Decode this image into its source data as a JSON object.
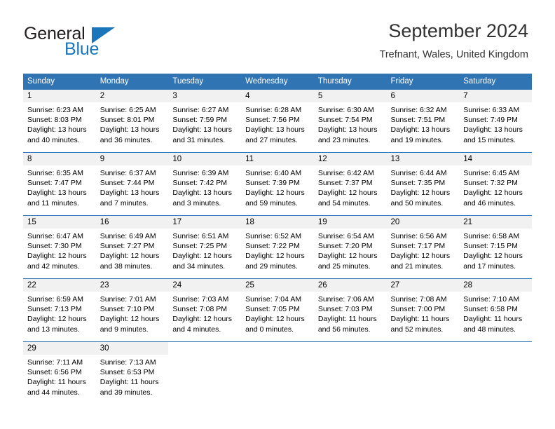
{
  "logo": {
    "word1": "General",
    "word2": "Blue",
    "triangle_color": "#1b75bb"
  },
  "header": {
    "title": "September 2024",
    "subtitle": "Trefnant, Wales, United Kingdom"
  },
  "theme": {
    "header_blue": "#3174b4",
    "daynum_band": "#f1f1f1",
    "text": "#000000"
  },
  "weekday_headers": [
    "Sunday",
    "Monday",
    "Tuesday",
    "Wednesday",
    "Thursday",
    "Friday",
    "Saturday"
  ],
  "weeks": [
    [
      {
        "day": "1",
        "sunrise": "Sunrise: 6:23 AM",
        "sunset": "Sunset: 8:03 PM",
        "daylight1": "Daylight: 13 hours",
        "daylight2": "and 40 minutes."
      },
      {
        "day": "2",
        "sunrise": "Sunrise: 6:25 AM",
        "sunset": "Sunset: 8:01 PM",
        "daylight1": "Daylight: 13 hours",
        "daylight2": "and 36 minutes."
      },
      {
        "day": "3",
        "sunrise": "Sunrise: 6:27 AM",
        "sunset": "Sunset: 7:59 PM",
        "daylight1": "Daylight: 13 hours",
        "daylight2": "and 31 minutes."
      },
      {
        "day": "4",
        "sunrise": "Sunrise: 6:28 AM",
        "sunset": "Sunset: 7:56 PM",
        "daylight1": "Daylight: 13 hours",
        "daylight2": "and 27 minutes."
      },
      {
        "day": "5",
        "sunrise": "Sunrise: 6:30 AM",
        "sunset": "Sunset: 7:54 PM",
        "daylight1": "Daylight: 13 hours",
        "daylight2": "and 23 minutes."
      },
      {
        "day": "6",
        "sunrise": "Sunrise: 6:32 AM",
        "sunset": "Sunset: 7:51 PM",
        "daylight1": "Daylight: 13 hours",
        "daylight2": "and 19 minutes."
      },
      {
        "day": "7",
        "sunrise": "Sunrise: 6:33 AM",
        "sunset": "Sunset: 7:49 PM",
        "daylight1": "Daylight: 13 hours",
        "daylight2": "and 15 minutes."
      }
    ],
    [
      {
        "day": "8",
        "sunrise": "Sunrise: 6:35 AM",
        "sunset": "Sunset: 7:47 PM",
        "daylight1": "Daylight: 13 hours",
        "daylight2": "and 11 minutes."
      },
      {
        "day": "9",
        "sunrise": "Sunrise: 6:37 AM",
        "sunset": "Sunset: 7:44 PM",
        "daylight1": "Daylight: 13 hours",
        "daylight2": "and 7 minutes."
      },
      {
        "day": "10",
        "sunrise": "Sunrise: 6:39 AM",
        "sunset": "Sunset: 7:42 PM",
        "daylight1": "Daylight: 13 hours",
        "daylight2": "and 3 minutes."
      },
      {
        "day": "11",
        "sunrise": "Sunrise: 6:40 AM",
        "sunset": "Sunset: 7:39 PM",
        "daylight1": "Daylight: 12 hours",
        "daylight2": "and 59 minutes."
      },
      {
        "day": "12",
        "sunrise": "Sunrise: 6:42 AM",
        "sunset": "Sunset: 7:37 PM",
        "daylight1": "Daylight: 12 hours",
        "daylight2": "and 54 minutes."
      },
      {
        "day": "13",
        "sunrise": "Sunrise: 6:44 AM",
        "sunset": "Sunset: 7:35 PM",
        "daylight1": "Daylight: 12 hours",
        "daylight2": "and 50 minutes."
      },
      {
        "day": "14",
        "sunrise": "Sunrise: 6:45 AM",
        "sunset": "Sunset: 7:32 PM",
        "daylight1": "Daylight: 12 hours",
        "daylight2": "and 46 minutes."
      }
    ],
    [
      {
        "day": "15",
        "sunrise": "Sunrise: 6:47 AM",
        "sunset": "Sunset: 7:30 PM",
        "daylight1": "Daylight: 12 hours",
        "daylight2": "and 42 minutes."
      },
      {
        "day": "16",
        "sunrise": "Sunrise: 6:49 AM",
        "sunset": "Sunset: 7:27 PM",
        "daylight1": "Daylight: 12 hours",
        "daylight2": "and 38 minutes."
      },
      {
        "day": "17",
        "sunrise": "Sunrise: 6:51 AM",
        "sunset": "Sunset: 7:25 PM",
        "daylight1": "Daylight: 12 hours",
        "daylight2": "and 34 minutes."
      },
      {
        "day": "18",
        "sunrise": "Sunrise: 6:52 AM",
        "sunset": "Sunset: 7:22 PM",
        "daylight1": "Daylight: 12 hours",
        "daylight2": "and 29 minutes."
      },
      {
        "day": "19",
        "sunrise": "Sunrise: 6:54 AM",
        "sunset": "Sunset: 7:20 PM",
        "daylight1": "Daylight: 12 hours",
        "daylight2": "and 25 minutes."
      },
      {
        "day": "20",
        "sunrise": "Sunrise: 6:56 AM",
        "sunset": "Sunset: 7:17 PM",
        "daylight1": "Daylight: 12 hours",
        "daylight2": "and 21 minutes."
      },
      {
        "day": "21",
        "sunrise": "Sunrise: 6:58 AM",
        "sunset": "Sunset: 7:15 PM",
        "daylight1": "Daylight: 12 hours",
        "daylight2": "and 17 minutes."
      }
    ],
    [
      {
        "day": "22",
        "sunrise": "Sunrise: 6:59 AM",
        "sunset": "Sunset: 7:13 PM",
        "daylight1": "Daylight: 12 hours",
        "daylight2": "and 13 minutes."
      },
      {
        "day": "23",
        "sunrise": "Sunrise: 7:01 AM",
        "sunset": "Sunset: 7:10 PM",
        "daylight1": "Daylight: 12 hours",
        "daylight2": "and 9 minutes."
      },
      {
        "day": "24",
        "sunrise": "Sunrise: 7:03 AM",
        "sunset": "Sunset: 7:08 PM",
        "daylight1": "Daylight: 12 hours",
        "daylight2": "and 4 minutes."
      },
      {
        "day": "25",
        "sunrise": "Sunrise: 7:04 AM",
        "sunset": "Sunset: 7:05 PM",
        "daylight1": "Daylight: 12 hours",
        "daylight2": "and 0 minutes."
      },
      {
        "day": "26",
        "sunrise": "Sunrise: 7:06 AM",
        "sunset": "Sunset: 7:03 PM",
        "daylight1": "Daylight: 11 hours",
        "daylight2": "and 56 minutes."
      },
      {
        "day": "27",
        "sunrise": "Sunrise: 7:08 AM",
        "sunset": "Sunset: 7:00 PM",
        "daylight1": "Daylight: 11 hours",
        "daylight2": "and 52 minutes."
      },
      {
        "day": "28",
        "sunrise": "Sunrise: 7:10 AM",
        "sunset": "Sunset: 6:58 PM",
        "daylight1": "Daylight: 11 hours",
        "daylight2": "and 48 minutes."
      }
    ],
    [
      {
        "day": "29",
        "sunrise": "Sunrise: 7:11 AM",
        "sunset": "Sunset: 6:56 PM",
        "daylight1": "Daylight: 11 hours",
        "daylight2": "and 44 minutes."
      },
      {
        "day": "30",
        "sunrise": "Sunrise: 7:13 AM",
        "sunset": "Sunset: 6:53 PM",
        "daylight1": "Daylight: 11 hours",
        "daylight2": "and 39 minutes."
      },
      {
        "day": "",
        "sunrise": "",
        "sunset": "",
        "daylight1": "",
        "daylight2": ""
      },
      {
        "day": "",
        "sunrise": "",
        "sunset": "",
        "daylight1": "",
        "daylight2": ""
      },
      {
        "day": "",
        "sunrise": "",
        "sunset": "",
        "daylight1": "",
        "daylight2": ""
      },
      {
        "day": "",
        "sunrise": "",
        "sunset": "",
        "daylight1": "",
        "daylight2": ""
      },
      {
        "day": "",
        "sunrise": "",
        "sunset": "",
        "daylight1": "",
        "daylight2": ""
      }
    ]
  ]
}
